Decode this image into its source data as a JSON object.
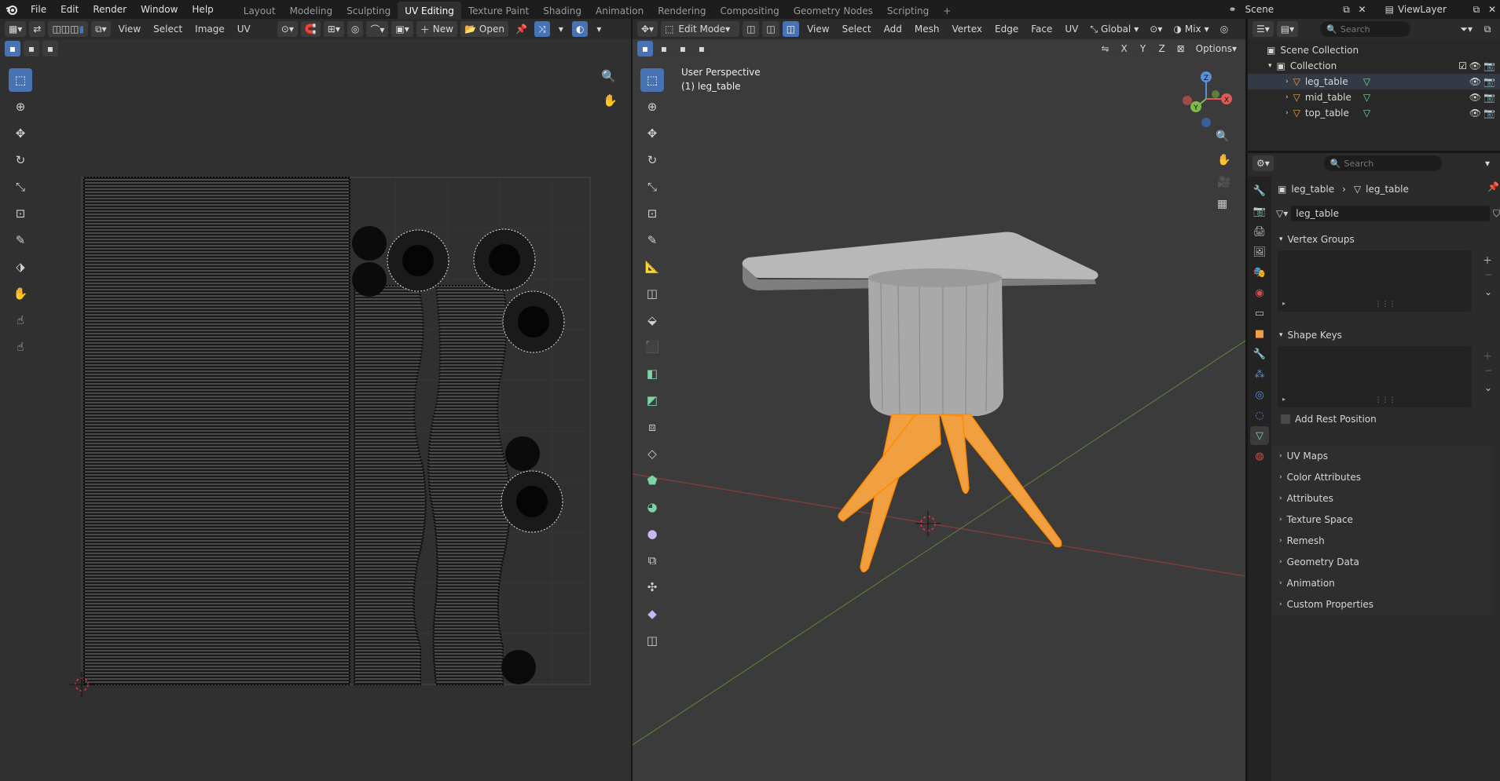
{
  "app": {
    "logo_icon": "blender-logo-icon",
    "accent": "#4772b3",
    "selection": "#f5a33d"
  },
  "menubar": {
    "items": [
      "File",
      "Edit",
      "Render",
      "Window",
      "Help"
    ]
  },
  "workspaces": {
    "tabs": [
      "Layout",
      "Modeling",
      "Sculpting",
      "UV Editing",
      "Texture Paint",
      "Shading",
      "Animation",
      "Rendering",
      "Compositing",
      "Geometry Nodes",
      "Scripting"
    ],
    "active": "UV Editing",
    "add_label": "+"
  },
  "scene": {
    "label": "Scene",
    "view_layer": "ViewLayer"
  },
  "uv_editor": {
    "menus": [
      "View",
      "Select",
      "Image",
      "UV"
    ],
    "new_label": "New",
    "open_label": "Open"
  },
  "viewport": {
    "mode": "Edit Mode",
    "menus": [
      "View",
      "Select",
      "Add",
      "Mesh",
      "Vertex",
      "Edge",
      "Face",
      "UV"
    ],
    "orientation": "Global",
    "snap_mix": "Mix",
    "options_label": "Options",
    "axes": [
      "X",
      "Y",
      "Z"
    ],
    "perspective": "User Perspective",
    "object_info": "(1) leg_table"
  },
  "outliner": {
    "search_placeholder": "Search",
    "scene_collection": "Scene Collection",
    "collection": "Collection",
    "objects": [
      "leg_table",
      "mid_table",
      "top_table"
    ]
  },
  "properties": {
    "search_placeholder": "Search",
    "breadcrumb_object": "leg_table",
    "breadcrumb_mesh": "leg_table",
    "mesh_name": "leg_table",
    "vertex_groups": "Vertex Groups",
    "shape_keys": "Shape Keys",
    "add_rest_position": "Add Rest Position",
    "sections": [
      "UV Maps",
      "Color Attributes",
      "Attributes",
      "Texture Space",
      "Remesh",
      "Geometry Data",
      "Animation",
      "Custom Properties"
    ]
  }
}
